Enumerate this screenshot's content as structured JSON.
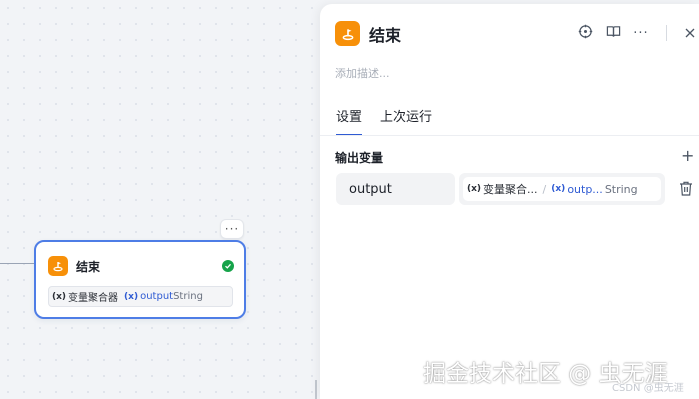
{
  "canvas": {
    "node": {
      "title": "结束",
      "icon": "end-flag-icon",
      "status_icon": "check-circle-icon",
      "menu_icon": "more-horizontal-icon",
      "menu_label": "···",
      "output": {
        "var_marker": "(x)",
        "source": "变量聚合器",
        "name": "output",
        "type": "String"
      }
    }
  },
  "panel": {
    "title": "结束",
    "icon": "end-flag-icon",
    "description_placeholder": "添加描述...",
    "toolbar": {
      "run_icon": "crosshair-icon",
      "book_icon": "book-icon",
      "more_icon": "more-horizontal-icon",
      "more_label": "···",
      "close_icon": "close-icon"
    },
    "tabs": [
      {
        "label": "设置",
        "active": true
      },
      {
        "label": "上次运行",
        "active": false
      }
    ],
    "output_section": {
      "title": "输出变量",
      "add_label": "+",
      "rows": [
        {
          "name": "output",
          "ref": {
            "var_marker": "(x)",
            "source": "变量聚合...",
            "separator": "/",
            "name": "outp...",
            "type": "String"
          },
          "delete_icon": "trash-icon"
        }
      ]
    }
  },
  "watermark": {
    "main": "掘金技术社区 @ 虫无涯",
    "csdn": "CSDN @虫无涯"
  },
  "colors": {
    "accent": "#2f5bd3",
    "node_border": "#4e7de6",
    "end_icon_bg": "#f79009",
    "success": "#16a34a"
  }
}
